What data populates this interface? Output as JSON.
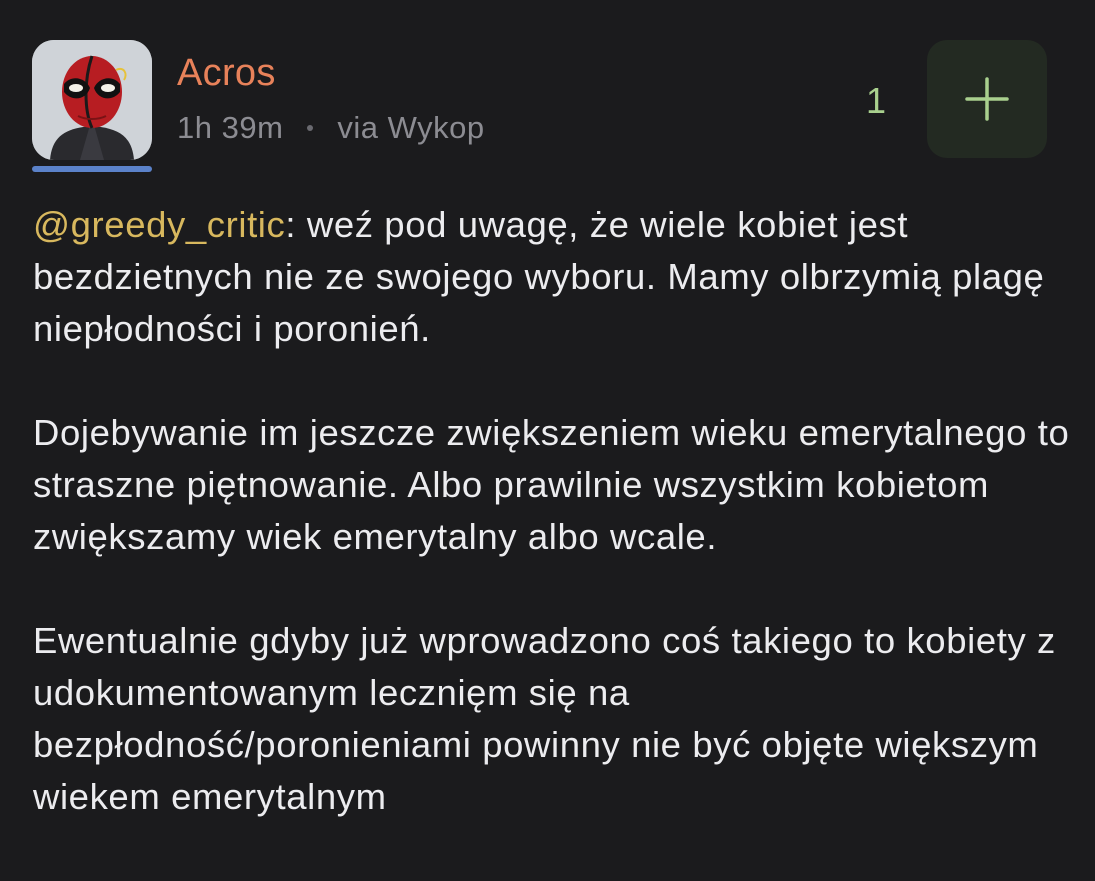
{
  "post": {
    "author": "Acros",
    "time": "1h 39m",
    "via": "via Wykop",
    "vote_count": "1",
    "mention": "@greedy_critic",
    "paragraph1_rest": ": weź pod uwagę, że wiele kobiet jest bezdzietnych nie ze swojego wyboru. Mamy olbrzymią plagę niepłodności i poronień.",
    "paragraph2": "Dojebywanie im jeszcze zwiększeniem wieku emerytalnego to straszne piętnowanie. Albo prawilnie wszystkim kobietom zwiększamy wiek emerytalny albo wcale.",
    "paragraph3": "Ewentualnie gdyby już wprowadzono coś takiego to kobiety z udokumentowanym lecznięm się na bezpłodność/poronieniami powinny nie być objęte większym wiekem emerytalnym"
  },
  "icons": {
    "avatar": "deadpool-avatar",
    "plus": "plus-icon"
  },
  "colors": {
    "background": "#1b1b1d",
    "author": "#e8825a",
    "mention": "#d8b85e",
    "vote": "#a9d08e",
    "plus_button_bg": "#232a22",
    "avatar_underline": "#5b82c9"
  }
}
